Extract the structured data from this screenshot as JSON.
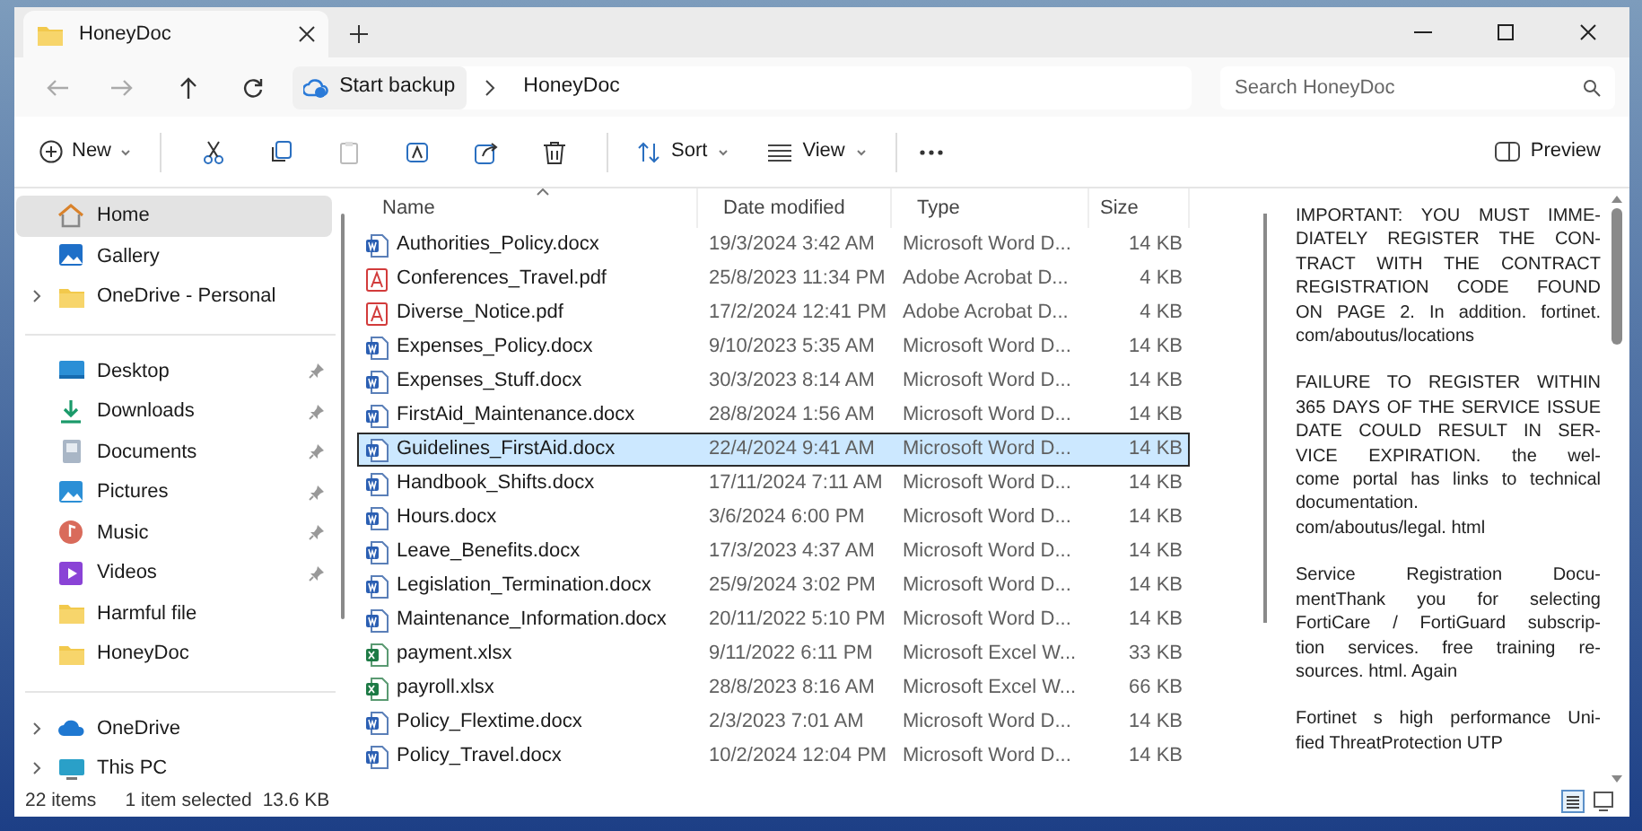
{
  "tab": {
    "title": "HoneyDoc"
  },
  "address": {
    "segments": [
      "Start backup",
      "HoneyDoc"
    ],
    "search_placeholder": "Search HoneyDoc"
  },
  "toolbar": {
    "new": "New",
    "sort": "Sort",
    "view": "View",
    "preview": "Preview"
  },
  "sidebar": {
    "groups": [
      [
        {
          "label": "Home",
          "kind": "home",
          "selected": true,
          "pinned": false,
          "expandable": false
        },
        {
          "label": "Gallery",
          "kind": "gallery",
          "selected": false,
          "pinned": false,
          "expandable": false
        },
        {
          "label": "OneDrive - Personal",
          "kind": "folder",
          "selected": false,
          "pinned": false,
          "expandable": true
        }
      ],
      [
        {
          "label": "Desktop",
          "kind": "desktop",
          "selected": false,
          "pinned": true,
          "expandable": false
        },
        {
          "label": "Downloads",
          "kind": "downloads",
          "selected": false,
          "pinned": true,
          "expandable": false
        },
        {
          "label": "Documents",
          "kind": "documents",
          "selected": false,
          "pinned": true,
          "expandable": false
        },
        {
          "label": "Pictures",
          "kind": "pictures",
          "selected": false,
          "pinned": true,
          "expandable": false
        },
        {
          "label": "Music",
          "kind": "music",
          "selected": false,
          "pinned": true,
          "expandable": false
        },
        {
          "label": "Videos",
          "kind": "videos",
          "selected": false,
          "pinned": true,
          "expandable": false
        },
        {
          "label": "Harmful file",
          "kind": "folder",
          "selected": false,
          "pinned": false,
          "expandable": false
        },
        {
          "label": "HoneyDoc",
          "kind": "folder",
          "selected": false,
          "pinned": false,
          "expandable": false
        }
      ],
      [
        {
          "label": "OneDrive",
          "kind": "cloud",
          "selected": false,
          "pinned": false,
          "expandable": true
        },
        {
          "label": "This PC",
          "kind": "pc",
          "selected": false,
          "pinned": false,
          "expandable": true
        }
      ]
    ]
  },
  "table": {
    "columns": [
      "Name",
      "Date modified",
      "Type",
      "Size"
    ],
    "rows": [
      {
        "name": "Authorities_Policy.docx",
        "date": "19/3/2024 3:42 AM",
        "type": "Microsoft Word D...",
        "size": "14 KB",
        "kind": "word",
        "selected": false
      },
      {
        "name": "Conferences_Travel.pdf",
        "date": "25/8/2023 11:34 PM",
        "type": "Adobe Acrobat D...",
        "size": "4 KB",
        "kind": "pdf",
        "selected": false
      },
      {
        "name": "Diverse_Notice.pdf",
        "date": "17/2/2024 12:41 PM",
        "type": "Adobe Acrobat D...",
        "size": "4 KB",
        "kind": "pdf",
        "selected": false
      },
      {
        "name": "Expenses_Policy.docx",
        "date": "9/10/2023 5:35 AM",
        "type": "Microsoft Word D...",
        "size": "14 KB",
        "kind": "word",
        "selected": false
      },
      {
        "name": "Expenses_Stuff.docx",
        "date": "30/3/2023 8:14 AM",
        "type": "Microsoft Word D...",
        "size": "14 KB",
        "kind": "word",
        "selected": false
      },
      {
        "name": "FirstAid_Maintenance.docx",
        "date": "28/8/2024 1:56 AM",
        "type": "Microsoft Word D...",
        "size": "14 KB",
        "kind": "word",
        "selected": false
      },
      {
        "name": "Guidelines_FirstAid.docx",
        "date": "22/4/2024 9:41 AM",
        "type": "Microsoft Word D...",
        "size": "14 KB",
        "kind": "word",
        "selected": true
      },
      {
        "name": "Handbook_Shifts.docx",
        "date": "17/11/2024 7:11 AM",
        "type": "Microsoft Word D...",
        "size": "14 KB",
        "kind": "word",
        "selected": false
      },
      {
        "name": "Hours.docx",
        "date": "3/6/2024 6:00 PM",
        "type": "Microsoft Word D...",
        "size": "14 KB",
        "kind": "word",
        "selected": false
      },
      {
        "name": "Leave_Benefits.docx",
        "date": "17/3/2023 4:37 AM",
        "type": "Microsoft Word D...",
        "size": "14 KB",
        "kind": "word",
        "selected": false
      },
      {
        "name": "Legislation_Termination.docx",
        "date": "25/9/2024 3:02 PM",
        "type": "Microsoft Word D...",
        "size": "14 KB",
        "kind": "word",
        "selected": false
      },
      {
        "name": "Maintenance_Information.docx",
        "date": "20/11/2022 5:10 PM",
        "type": "Microsoft Word D...",
        "size": "14 KB",
        "kind": "word",
        "selected": false
      },
      {
        "name": "payment.xlsx",
        "date": "9/11/2022 6:11 PM",
        "type": "Microsoft Excel W...",
        "size": "33 KB",
        "kind": "excel",
        "selected": false
      },
      {
        "name": "payroll.xlsx",
        "date": "28/8/2023 8:16 AM",
        "type": "Microsoft Excel W...",
        "size": "66 KB",
        "kind": "excel",
        "selected": false
      },
      {
        "name": "Policy_Flextime.docx",
        "date": "2/3/2023 7:01 AM",
        "type": "Microsoft Word D...",
        "size": "14 KB",
        "kind": "word",
        "selected": false
      },
      {
        "name": "Policy_Travel.docx",
        "date": "10/2/2024 12:04 PM",
        "type": "Microsoft Word D...",
        "size": "14 KB",
        "kind": "word",
        "selected": false
      }
    ]
  },
  "preview": {
    "paragraphs": [
      [
        "IMPORTANT: YOU MUST IMME-",
        "DIATELY REGISTER THE CON-",
        "TRACT WITH THE CONTRACT",
        "REGISTRATION CODE FOUND",
        "ON PAGE 2. In addition. fortinet.",
        "com/aboutus/locations"
      ],
      [
        "FAILURE TO REGISTER WITHIN",
        "365 DAYS OF THE SERVICE ISSUE",
        "DATE COULD RESULT IN SER-",
        "VICE EXPIRATION.   the wel-",
        "come portal has links to technical",
        "documentation.",
        "com/aboutus/legal. html"
      ],
      [
        "Service Registration Docu-",
        "mentThank you for selecting",
        "FortiCare / FortiGuard subscrip-",
        "tion services.  free training re-",
        "sources. html. Again"
      ],
      [
        "Fortinet s high performance Uni-",
        "fied ThreatProtection UTP"
      ]
    ]
  },
  "status": {
    "count": "22 items",
    "selection": "1 item selected",
    "size": "13.6 KB"
  }
}
